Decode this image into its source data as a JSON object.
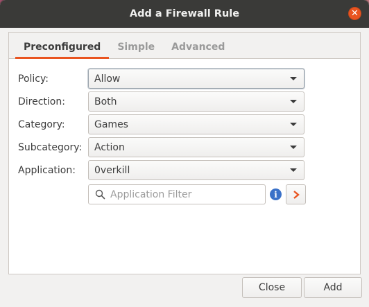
{
  "window": {
    "title": "Add a Firewall Rule",
    "close_icon": "close-icon",
    "accent_color": "#e95420"
  },
  "tabs": [
    {
      "label": "Preconfigured",
      "active": true
    },
    {
      "label": "Simple",
      "active": false
    },
    {
      "label": "Advanced",
      "active": false
    }
  ],
  "form": {
    "policy": {
      "label": "Policy:",
      "value": "Allow"
    },
    "direction": {
      "label": "Direction:",
      "value": "Both"
    },
    "category": {
      "label": "Category:",
      "value": "Games"
    },
    "subcategory": {
      "label": "Subcategory:",
      "value": "Action"
    },
    "application": {
      "label": "Application:",
      "value": "0verkill"
    },
    "filter": {
      "placeholder": "Application Filter",
      "icon": "search-icon"
    },
    "info_icon": "info-icon",
    "go_icon": "chevron-right-icon"
  },
  "footer": {
    "close_label": "Close",
    "add_label": "Add"
  }
}
